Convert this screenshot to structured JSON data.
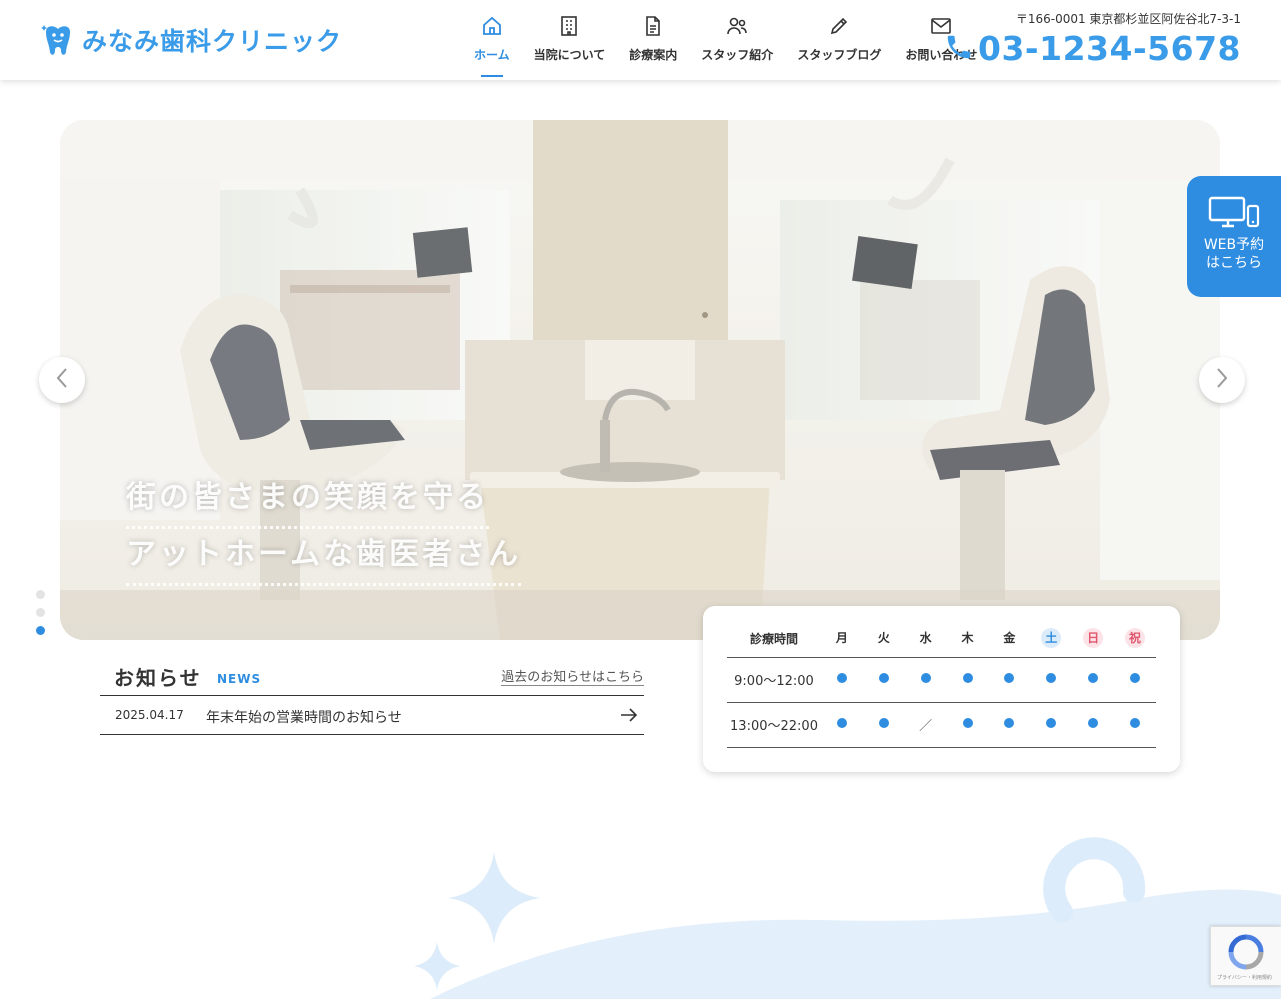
{
  "header": {
    "logo_text": "みなみ歯科クリニック",
    "nav": [
      {
        "label": "ホーム",
        "icon": "home-icon",
        "active": true
      },
      {
        "label": "当院について",
        "icon": "building-icon",
        "active": false
      },
      {
        "label": "診療案内",
        "icon": "document-icon",
        "active": false
      },
      {
        "label": "スタッフ紹介",
        "icon": "users-icon",
        "active": false
      },
      {
        "label": "スタッフブログ",
        "icon": "pencil-icon",
        "active": false
      },
      {
        "label": "お問い合わせ",
        "icon": "mail-icon",
        "active": false
      }
    ],
    "address": "〒166-0001 東京都杉並区阿佐谷北7-3-1",
    "phone": "03-1234-5678"
  },
  "hero": {
    "line1": "街の皆さまの笑顔を守る",
    "line2": "アットホームな歯医者さん",
    "slide_count": 3,
    "active_slide": 3
  },
  "web_booking": {
    "line1": "WEB予約",
    "line2": "はこちら"
  },
  "news": {
    "title": "お知らせ",
    "subtitle": "NEWS",
    "more_link": "過去のお知らせはこちら",
    "items": [
      {
        "date": "2025.04.17",
        "text": "年末年始の営業時間のお知らせ"
      }
    ]
  },
  "schedule": {
    "header_label": "診療時間",
    "days": [
      "月",
      "火",
      "水",
      "木",
      "金",
      "土",
      "日",
      "祝"
    ],
    "rows": [
      {
        "time": "9:00〜12:00",
        "marks": [
          "dot",
          "dot",
          "dot",
          "dot",
          "dot",
          "dot",
          "dot",
          "dot"
        ]
      },
      {
        "time": "13:00〜22:00",
        "marks": [
          "dot",
          "dot",
          "slash",
          "dot",
          "dot",
          "dot",
          "dot",
          "dot"
        ]
      }
    ],
    "slash_glyph": "／"
  },
  "recaptcha": {
    "text": "プライバシー・利用規約"
  },
  "colors": {
    "accent": "#2e8de0",
    "logo": "#3a9be8",
    "saturday": "#2e8de0",
    "sunday": "#e0566d"
  }
}
